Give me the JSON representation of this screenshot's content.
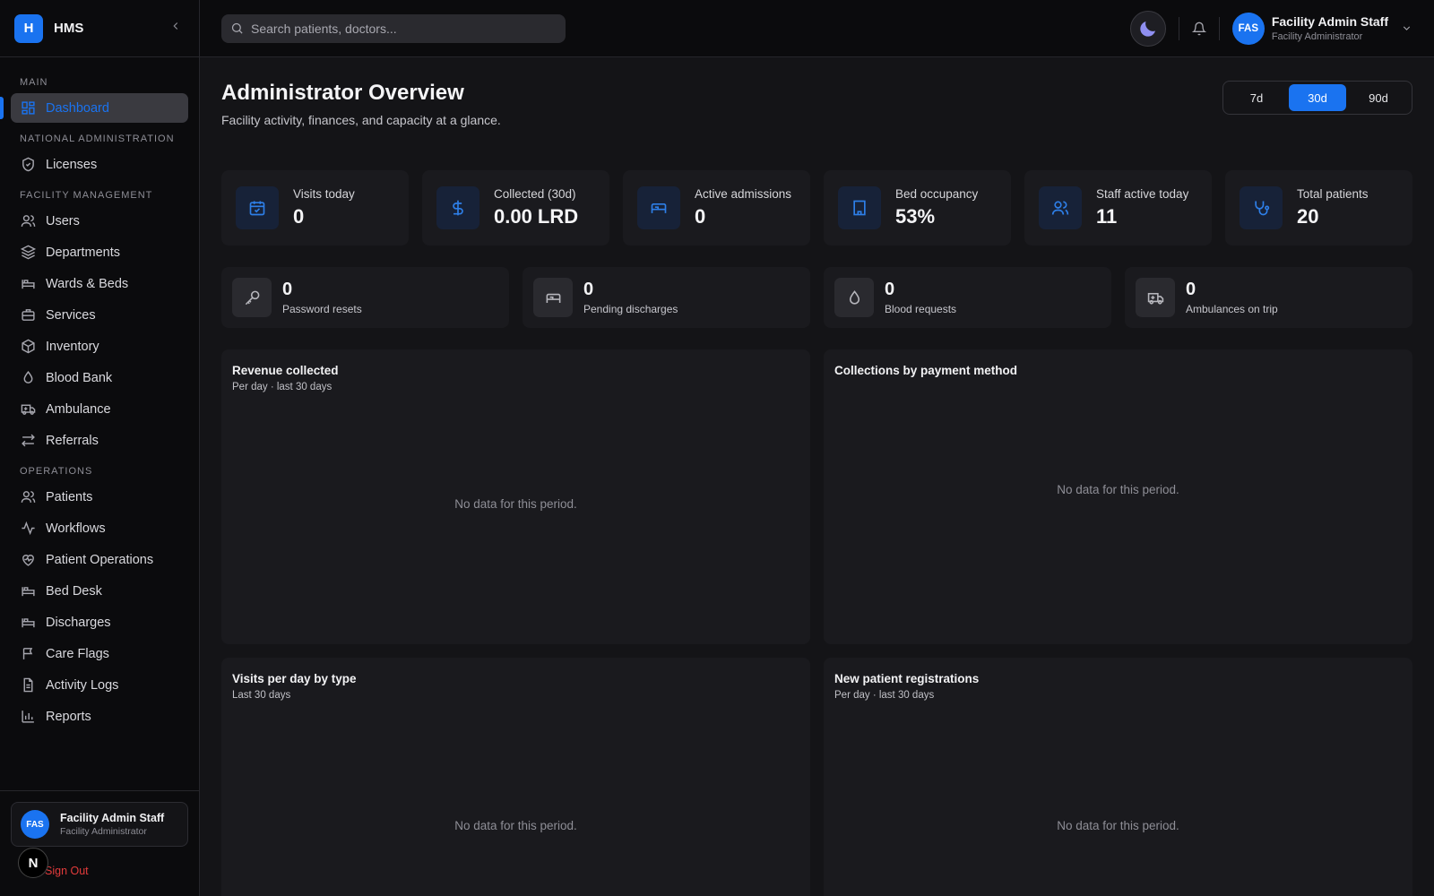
{
  "brand": {
    "logo_letter": "H",
    "name": "HMS",
    "collapse_icon": "chevron-left-icon"
  },
  "sidebar": {
    "sections": [
      {
        "label": "MAIN",
        "items": [
          {
            "label": "Dashboard",
            "icon": "dashboard-icon",
            "active": true
          }
        ]
      },
      {
        "label": "NATIONAL ADMINISTRATION",
        "items": [
          {
            "label": "Licenses",
            "icon": "shield-check-icon"
          }
        ]
      },
      {
        "label": "FACILITY MANAGEMENT",
        "items": [
          {
            "label": "Users",
            "icon": "users-icon"
          },
          {
            "label": "Departments",
            "icon": "layers-icon"
          },
          {
            "label": "Wards & Beds",
            "icon": "bed-icon"
          },
          {
            "label": "Services",
            "icon": "briefcase-icon"
          },
          {
            "label": "Inventory",
            "icon": "package-icon"
          },
          {
            "label": "Blood Bank",
            "icon": "droplet-icon"
          },
          {
            "label": "Ambulance",
            "icon": "ambulance-icon"
          },
          {
            "label": "Referrals",
            "icon": "arrows-exchange-icon"
          }
        ]
      },
      {
        "label": "OPERATIONS",
        "items": [
          {
            "label": "Patients",
            "icon": "users-icon"
          },
          {
            "label": "Workflows",
            "icon": "activity-icon"
          },
          {
            "label": "Patient Operations",
            "icon": "heart-pulse-icon"
          },
          {
            "label": "Bed Desk",
            "icon": "bed-icon"
          },
          {
            "label": "Discharges",
            "icon": "bed-icon"
          },
          {
            "label": "Care Flags",
            "icon": "flag-icon"
          },
          {
            "label": "Activity Logs",
            "icon": "file-text-icon"
          },
          {
            "label": "Reports",
            "icon": "bar-chart-icon"
          }
        ]
      }
    ],
    "footer": {
      "avatar": "FAS",
      "name": "Facility Admin Staff",
      "role": "Facility Administrator",
      "signout": "Sign Out",
      "next_badge": "N"
    }
  },
  "topbar": {
    "search_placeholder": "Search patients, doctors...",
    "profile": {
      "avatar": "FAS",
      "name": "Facility Admin Staff",
      "role": "Facility Administrator"
    }
  },
  "page": {
    "title": "Administrator Overview",
    "subtitle": "Facility activity, finances, and capacity at a glance.",
    "ranges": [
      {
        "label": "7d"
      },
      {
        "label": "30d",
        "selected": true
      },
      {
        "label": "90d"
      }
    ]
  },
  "stats": [
    {
      "label": "Visits today",
      "value": "0",
      "icon": "calendar-check-icon"
    },
    {
      "label": "Collected (30d)",
      "value": "0.00 LRD",
      "icon": "dollar-icon"
    },
    {
      "label": "Active admissions",
      "value": "0",
      "icon": "bed-icon"
    },
    {
      "label": "Bed occupancy",
      "value": "53%",
      "icon": "building-icon"
    },
    {
      "label": "Staff active today",
      "value": "11",
      "icon": "users-icon"
    },
    {
      "label": "Total patients",
      "value": "20",
      "icon": "stethoscope-icon"
    }
  ],
  "minis": [
    {
      "value": "0",
      "label": "Password resets",
      "icon": "key-icon"
    },
    {
      "value": "0",
      "label": "Pending discharges",
      "icon": "bed-icon"
    },
    {
      "value": "0",
      "label": "Blood requests",
      "icon": "droplet-icon"
    },
    {
      "value": "0",
      "label": "Ambulances on trip",
      "icon": "ambulance-icon"
    }
  ],
  "panels": [
    {
      "title": "Revenue collected",
      "subtitle": "Per day · last 30 days",
      "empty": "No data for this period."
    },
    {
      "title": "Collections by payment method",
      "subtitle": "",
      "empty": "No data for this period."
    },
    {
      "title": "Visits per day by type",
      "subtitle": "Last 30 days",
      "empty": "No data for this period."
    },
    {
      "title": "New patient registrations",
      "subtitle": "Per day · last 30 days",
      "empty": "No data for this period."
    }
  ],
  "colors": {
    "accent": "#1a73f0",
    "danger": "#e23b3b",
    "background": "#141417",
    "sidebar": "#0b0b0d",
    "card": "#1a1a1e"
  }
}
